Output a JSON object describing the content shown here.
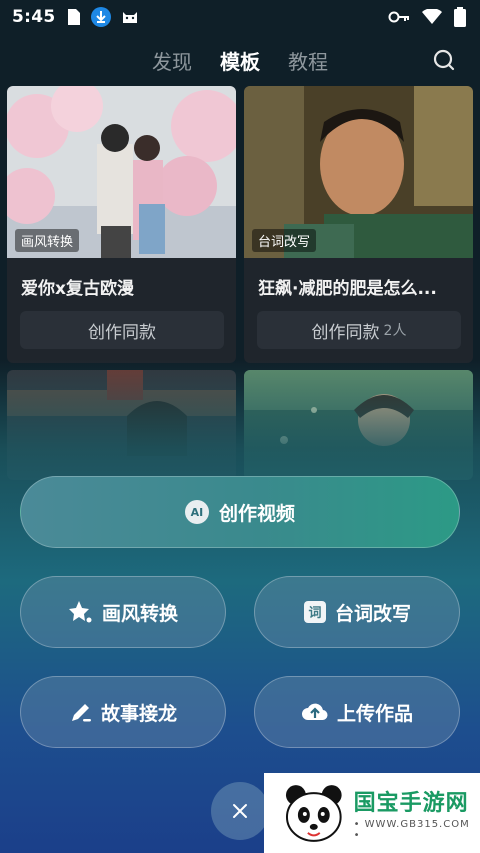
{
  "status": {
    "time": "5:45"
  },
  "nav": {
    "tabs": [
      "发现",
      "模板",
      "教程"
    ],
    "active_tab": "模板"
  },
  "cards": [
    {
      "tag": "画风转换",
      "title": "爱你x复古欧漫",
      "action": "创作同款",
      "count": ""
    },
    {
      "tag": "台词改写",
      "title": "狂飙·减肥的肥是怎么...",
      "action": "创作同款",
      "count": "2人"
    }
  ],
  "actions": {
    "create_video": "创作视频",
    "ai_badge": "AI",
    "style_transfer": "画风转换",
    "line_rewrite": "台词改写",
    "story_chain": "故事接龙",
    "upload_work": "上传作品"
  },
  "watermark": {
    "title": "国宝手游网",
    "url": "• WWW.GB315.COM •"
  },
  "colors": {
    "background": "#0f1f28",
    "accent_gradient_start": "#4b8a98",
    "accent_gradient_end": "#2c9a86",
    "watermark_green": "#1a9a63"
  }
}
